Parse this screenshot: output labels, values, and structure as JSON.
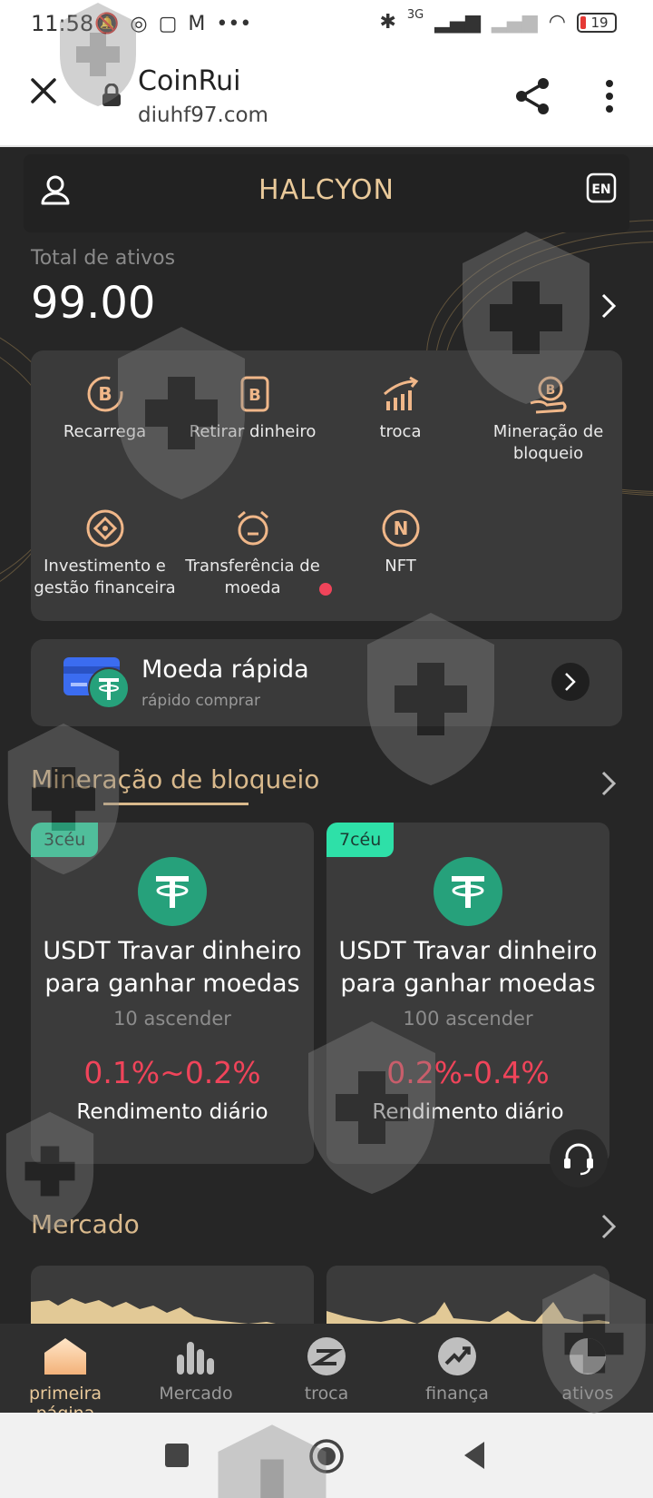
{
  "status_bar": {
    "time": "11:58",
    "network_label": "3G",
    "battery": "19"
  },
  "browser": {
    "site_name": "CoinRui",
    "url": "diuhf97.com"
  },
  "header": {
    "brand": "HALCYON",
    "lang": "EN"
  },
  "assets": {
    "label": "Total de ativos",
    "value": "99.00"
  },
  "actions": [
    {
      "label": "Recarrega",
      "icon": "bitcoin-recharge-icon"
    },
    {
      "label": "Retirar dinheiro",
      "icon": "bitcoin-withdraw-icon"
    },
    {
      "label": "troca",
      "icon": "bar-chart-trend-icon"
    },
    {
      "label": "Mineração de bloqueio",
      "icon": "bitcoin-hand-icon"
    },
    {
      "label": "Investimento e gestão financeira",
      "icon": "diamond-circle-icon"
    },
    {
      "label": "Transferência de moeda",
      "icon": "alarm-transfer-icon"
    },
    {
      "label": "NFT",
      "icon": "nft-icon"
    }
  ],
  "quick_coin": {
    "title": "Moeda rápida",
    "subtitle": "rápido comprar"
  },
  "mining": {
    "title": "Mineração de bloqueio",
    "cards": [
      {
        "tag": "3céu",
        "name": "USDT Travar dinheiro para ganhar moedas",
        "min": "10 ascender",
        "rate": "0.1%~0.2%",
        "rate_label": "Rendimento diário"
      },
      {
        "tag": "7céu",
        "name": "USDT Travar dinheiro para ganhar moedas",
        "min": "100 ascender",
        "rate": "0.2%-0.4%",
        "rate_label": "Rendimento diário"
      }
    ]
  },
  "market": {
    "title": "Mercado"
  },
  "tabs": [
    {
      "label": "primeira página",
      "active": true
    },
    {
      "label": "Mercado",
      "active": false
    },
    {
      "label": "troca",
      "active": false
    },
    {
      "label": "finança",
      "active": false
    },
    {
      "label": "ativos",
      "active": false
    }
  ],
  "colors": {
    "accent_gold": "#e9c99a",
    "rate_red": "#f0445a",
    "tag_green": "#2ee0a8",
    "tether_green": "#26a17b"
  }
}
